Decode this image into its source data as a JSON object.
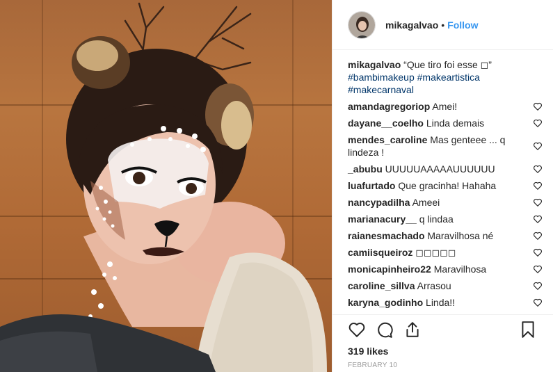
{
  "post": {
    "username": "mikagalvao",
    "follow_label": "Follow",
    "caption_text": "“Que tiro foi esse ◻”",
    "hashtags": [
      "#bambimakeup",
      "#makeartistica",
      "#makecarnaval"
    ]
  },
  "comments": [
    {
      "user": "amandagregoriop",
      "text": "Amei!"
    },
    {
      "user": "dayane__coelho",
      "text": "Linda demais"
    },
    {
      "user": "mendes_caroline",
      "text": "Mas genteee ... q lindeza !"
    },
    {
      "user": "_abubu",
      "text": "UUUUUAAAAAUUUUUU"
    },
    {
      "user": "luafurtado",
      "text": "Que gracinha! Hahaha"
    },
    {
      "user": "nancypadilha",
      "text": "Ameei"
    },
    {
      "user": "marianacury__",
      "text": "q lindaa"
    },
    {
      "user": "raianesmachado",
      "text": "Maravilhosa né"
    },
    {
      "user": "camiisqueiroz",
      "text": "◻◻◻◻◻"
    },
    {
      "user": "monicapinheiro22",
      "text": "Maravilhosa"
    },
    {
      "user": "caroline_sillva",
      "text": "Arrasou"
    },
    {
      "user": "karyna_godinho",
      "text": "Linda!!"
    }
  ],
  "stats": {
    "likes": "319 likes",
    "date": "FEBRUARY 10"
  },
  "icons": {
    "heart": "heart-icon",
    "comment": "comment-icon",
    "share": "share-icon",
    "save": "bookmark-icon"
  },
  "colors": {
    "follow": "#3897f0",
    "hashtag": "#003569",
    "text": "#262626",
    "muted": "#999999"
  }
}
